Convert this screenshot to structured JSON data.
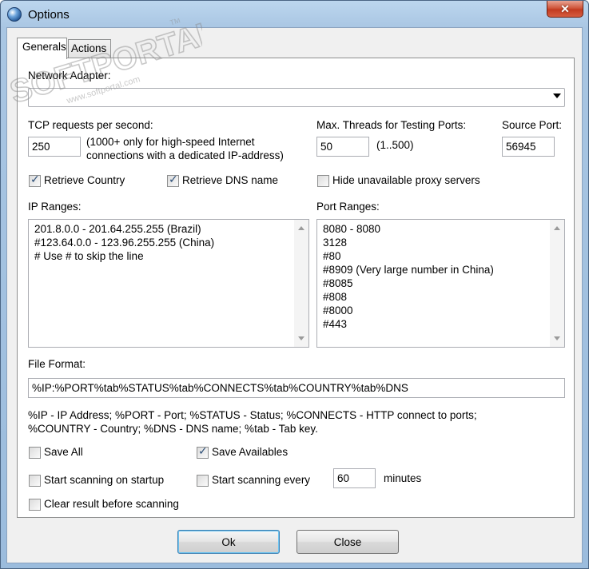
{
  "window": {
    "title": "Options",
    "close_symbol": "✕"
  },
  "watermark": {
    "brand": "SOFTPORTAL",
    "url": "www.softportal.com",
    "tm": "TM"
  },
  "tabs": [
    {
      "label": "Generals",
      "active": true
    },
    {
      "label": "Actions",
      "active": false
    }
  ],
  "general": {
    "network_adapter_label": "Network Adapter:",
    "network_adapter_value": "",
    "tcp_label": "TCP requests per second:",
    "tcp_value": "250",
    "tcp_hint_1": "(1000+ only for high-speed Internet",
    "tcp_hint_2": "connections with a dedicated IP-address)",
    "threads_label": "Max. Threads for Testing Ports:",
    "threads_value": "50",
    "threads_range": "(1..500)",
    "source_port_label": "Source Port:",
    "source_port_value": "56945",
    "retrieve_country_label": "Retrieve Country",
    "retrieve_country_checked": true,
    "retrieve_dns_label": "Retrieve DNS name",
    "retrieve_dns_checked": true,
    "hide_unavailable_label": "Hide unavailable proxy servers",
    "hide_unavailable_checked": false,
    "ip_ranges_label": "IP Ranges:",
    "ip_ranges": [
      "201.8.0.0 - 201.64.255.255 (Brazil)",
      "#123.64.0.0 - 123.96.255.255 (China)",
      "# Use # to skip the line"
    ],
    "port_ranges_label": "Port Ranges:",
    "port_ranges": [
      "8080 - 8080",
      "3128",
      "#80",
      "#8909 (Very large number in China)",
      "#8085",
      "#808",
      "#8000",
      "#443"
    ],
    "file_format_label": "File Format:",
    "file_format_value": "%IP:%PORT%tab%STATUS%tab%CONNECTS%tab%COUNTRY%tab%DNS",
    "format_help_1": "%IP - IP Address; %PORT - Port; %STATUS - Status; %CONNECTS - HTTP connect to ports;",
    "format_help_2": "%COUNTRY - Country; %DNS - DNS name; %tab - Tab key.",
    "save_all_label": "Save All",
    "save_all_checked": false,
    "save_availables_label": "Save Availables",
    "save_availables_checked": true,
    "start_on_startup_label": "Start scanning on startup",
    "start_on_startup_checked": false,
    "start_every_label": "Start scanning every",
    "start_every_checked": false,
    "interval_value": "60",
    "interval_unit": "minutes",
    "clear_result_label": "Clear result before scanning",
    "clear_result_checked": false
  },
  "buttons": {
    "ok": "Ok",
    "close": "Close"
  },
  "icons": {
    "app": "globe-icon",
    "close": "close-icon",
    "dropdown": "chevron-down-icon",
    "check": "checkmark-icon"
  }
}
